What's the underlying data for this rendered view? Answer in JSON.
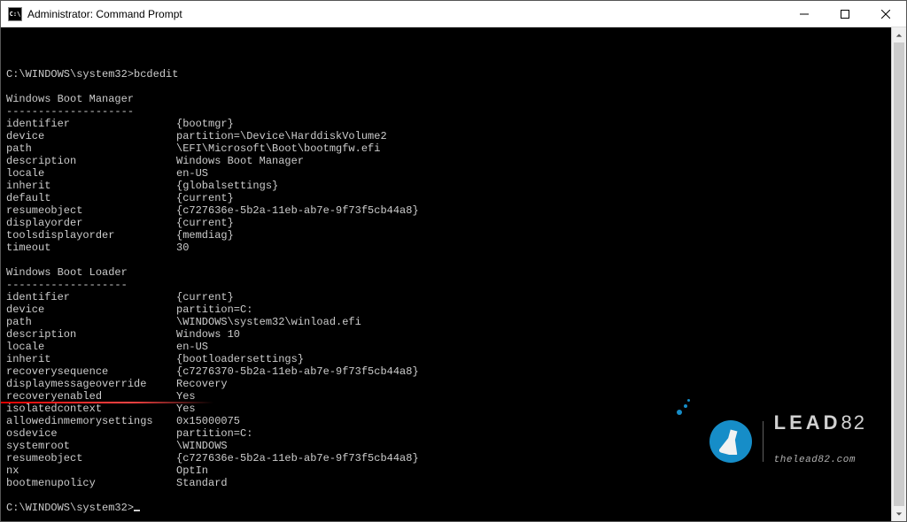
{
  "titlebar": {
    "icon_text": "C:\\",
    "title": "Administrator: Command Prompt"
  },
  "prompt": {
    "line1_path": "C:\\WINDOWS\\system32>",
    "line1_cmd": "bcdedit",
    "end_path": "C:\\WINDOWS\\system32>"
  },
  "sections": {
    "bootmgr": {
      "title": "Windows Boot Manager",
      "dashes": "--------------------",
      "rows": [
        {
          "k": "identifier",
          "v": "{bootmgr}"
        },
        {
          "k": "device",
          "v": "partition=\\Device\\HarddiskVolume2"
        },
        {
          "k": "path",
          "v": "\\EFI\\Microsoft\\Boot\\bootmgfw.efi"
        },
        {
          "k": "description",
          "v": "Windows Boot Manager"
        },
        {
          "k": "locale",
          "v": "en-US"
        },
        {
          "k": "inherit",
          "v": "{globalsettings}"
        },
        {
          "k": "default",
          "v": "{current}"
        },
        {
          "k": "resumeobject",
          "v": "{c727636e-5b2a-11eb-ab7e-9f73f5cb44a8}"
        },
        {
          "k": "displayorder",
          "v": "{current}"
        },
        {
          "k": "toolsdisplayorder",
          "v": "{memdiag}"
        },
        {
          "k": "timeout",
          "v": "30"
        }
      ]
    },
    "loader": {
      "title": "Windows Boot Loader",
      "dashes": "-------------------",
      "rows": [
        {
          "k": "identifier",
          "v": "{current}"
        },
        {
          "k": "device",
          "v": "partition=C:"
        },
        {
          "k": "path",
          "v": "\\WINDOWS\\system32\\winload.efi"
        },
        {
          "k": "description",
          "v": "Windows 10"
        },
        {
          "k": "locale",
          "v": "en-US"
        },
        {
          "k": "inherit",
          "v": "{bootloadersettings}"
        },
        {
          "k": "recoverysequence",
          "v": "{c7276370-5b2a-11eb-ab7e-9f73f5cb44a8}"
        },
        {
          "k": "displaymessageoverride",
          "v": "Recovery"
        },
        {
          "k": "recoveryenabled",
          "v": "Yes"
        },
        {
          "k": "isolatedcontext",
          "v": "Yes"
        },
        {
          "k": "allowedinmemorysettings",
          "v": "0x15000075"
        },
        {
          "k": "osdevice",
          "v": "partition=C:"
        },
        {
          "k": "systemroot",
          "v": "\\WINDOWS"
        },
        {
          "k": "resumeobject",
          "v": "{c727636e-5b2a-11eb-ab7e-9f73f5cb44a8}"
        },
        {
          "k": "nx",
          "v": "OptIn"
        },
        {
          "k": "bootmenupolicy",
          "v": "Standard"
        }
      ]
    }
  },
  "watermark": {
    "brand_bold": "LEAD",
    "brand_light": "82",
    "url": "thelead82.com"
  }
}
